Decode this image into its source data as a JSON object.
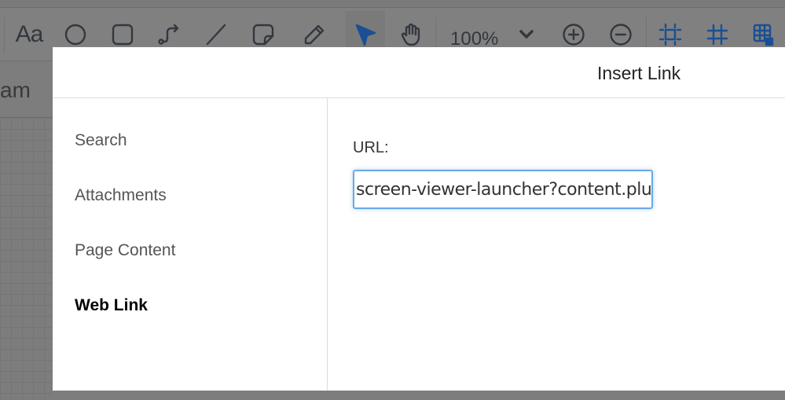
{
  "toolbar": {
    "text_tool": "Aa",
    "zoom_level": "100%"
  },
  "canvas": {
    "diagram_name_fragment": "am"
  },
  "dialog": {
    "title": "Insert Link",
    "nav": [
      {
        "label": "Search"
      },
      {
        "label": "Attachments"
      },
      {
        "label": "Page Content"
      },
      {
        "label": "Web Link",
        "active": true
      }
    ],
    "url_label": "URL:",
    "url_value": "screen-viewer-launcher?content.plu"
  },
  "colors": {
    "accent": "#1a4f93",
    "focus": "#6aa8ea"
  }
}
